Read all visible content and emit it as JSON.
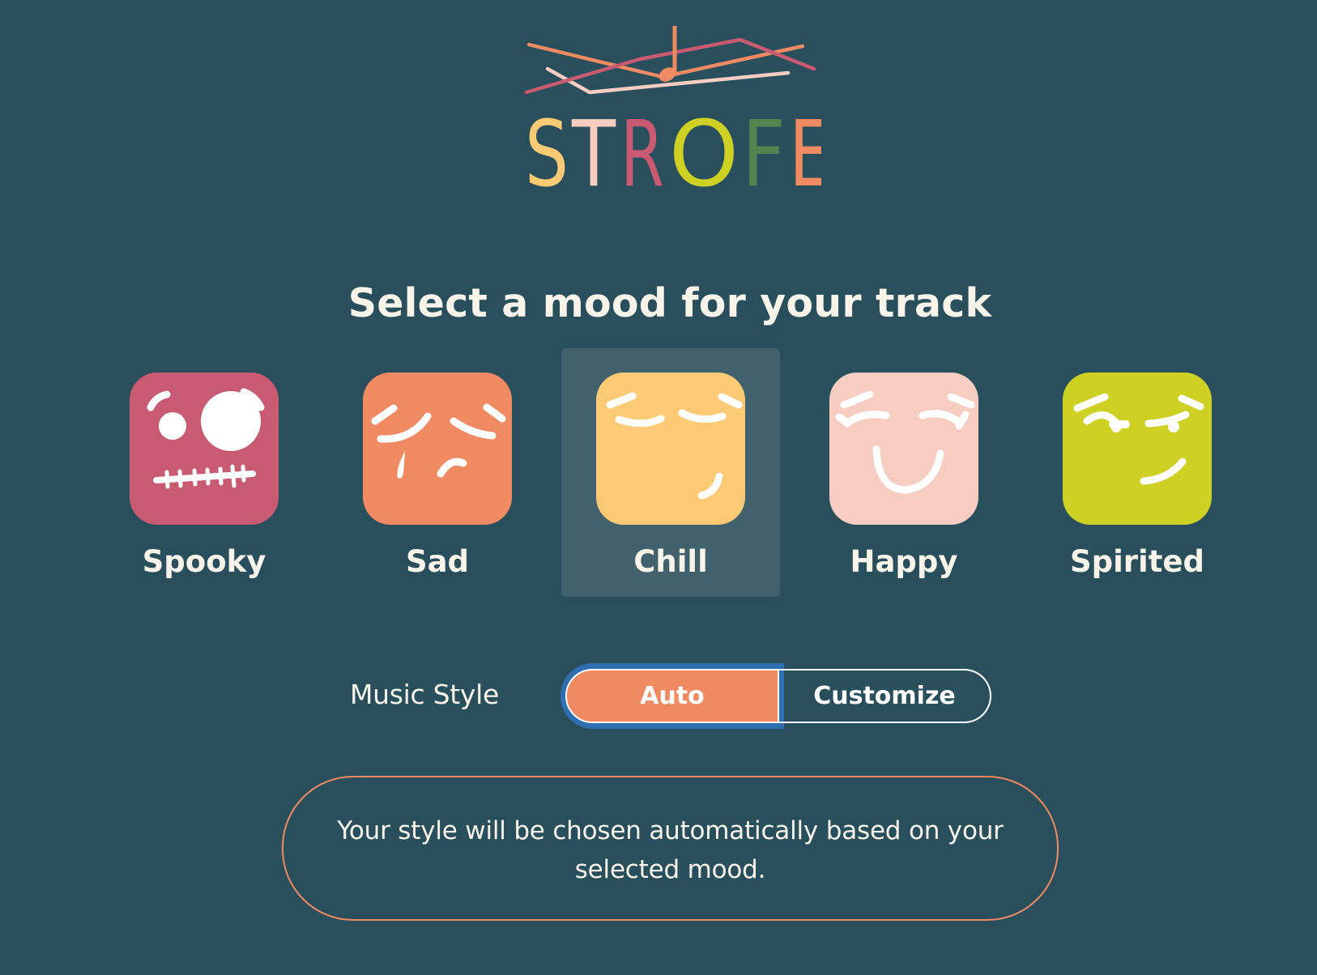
{
  "app": {
    "brand": "STROFE",
    "brand_letters": [
      {
        "char": "S",
        "color": "#fcc974"
      },
      {
        "char": "T",
        "color": "#f7cdc2"
      },
      {
        "char": "R",
        "color": "#c85a72"
      },
      {
        "char": "O",
        "color": "#ced024"
      },
      {
        "char": "F",
        "color": "#548550"
      },
      {
        "char": "E",
        "color": "#f08a62"
      }
    ]
  },
  "heading": "Select a mood for your track",
  "moods": [
    {
      "id": "spooky",
      "label": "Spooky",
      "color": "#c85a72",
      "icon": "spooky-face-icon",
      "selected": false
    },
    {
      "id": "sad",
      "label": "Sad",
      "color": "#f08a62",
      "icon": "sad-face-icon",
      "selected": false
    },
    {
      "id": "chill",
      "label": "Chill",
      "color": "#fcc974",
      "icon": "chill-face-icon",
      "selected": true
    },
    {
      "id": "happy",
      "label": "Happy",
      "color": "#f7cdc2",
      "icon": "happy-face-icon",
      "selected": false
    },
    {
      "id": "spirited",
      "label": "Spirited",
      "color": "#ced024",
      "icon": "spirited-face-icon",
      "selected": false
    }
  ],
  "music_style": {
    "label": "Music Style",
    "options": [
      {
        "label": "Auto",
        "selected": true
      },
      {
        "label": "Customize",
        "selected": false
      }
    ],
    "description": "Your style will be chosen automatically based on your selected mood."
  },
  "colors": {
    "background": "#294e5c",
    "selected_tile_bg": "#41616d",
    "accent": "#f08a62",
    "focus_ring": "#2f6fb1",
    "text": "#f8f4ea"
  }
}
